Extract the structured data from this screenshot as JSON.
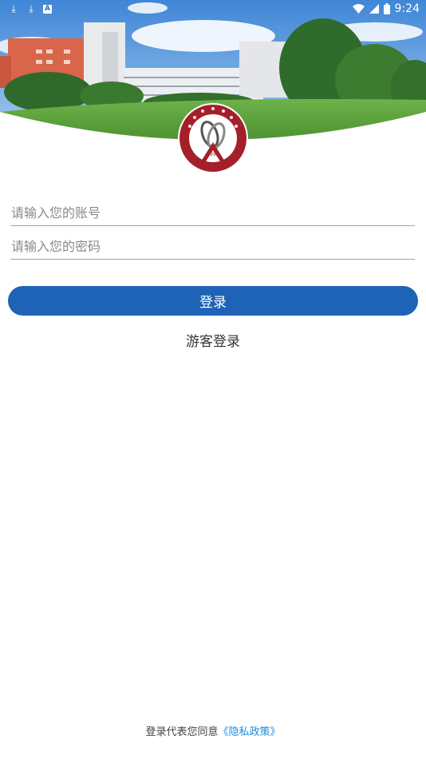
{
  "status_bar": {
    "time": "9:24",
    "left_icons": [
      "download-icon",
      "download-icon",
      "app-notification-icon"
    ],
    "app_badge_letter": "A",
    "right_icons": [
      "wifi-icon",
      "signal-icon",
      "battery-icon"
    ]
  },
  "logo": {
    "year": "1952"
  },
  "form": {
    "account_placeholder": "请输入您的账号",
    "password_placeholder": "请输入您的密码",
    "login_label": "登录",
    "guest_login_label": "游客登录"
  },
  "footer": {
    "privacy_prefix": "登录代表您同意",
    "privacy_link": "《隐私政策》"
  },
  "colors": {
    "primary": "#1e63b5",
    "link": "#1a8ee0",
    "logo_red": "#a3202a"
  }
}
